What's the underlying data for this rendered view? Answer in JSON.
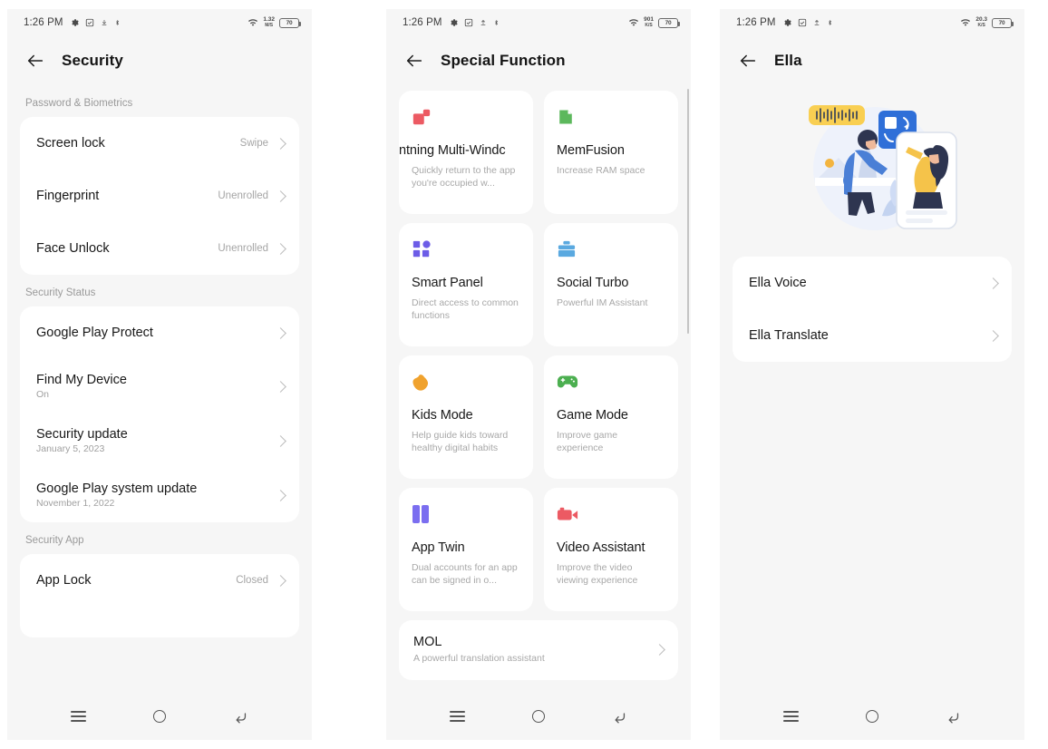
{
  "status_bar": {
    "time": "1:26 PM",
    "icons": [
      "gear-icon",
      "checkbox-icon",
      "download-icon",
      "bluetooth-icon"
    ],
    "wifi": "wifi-icon",
    "battery_level": "70",
    "speeds": [
      "1.32",
      "901",
      "20.3"
    ],
    "speed_units": [
      "M/S",
      "K/S",
      "K/S"
    ]
  },
  "nav_bar": {
    "recents_label": "recents",
    "home_label": "home",
    "back_label": "back"
  },
  "phone1": {
    "title": "Security",
    "groups": [
      {
        "label": "Password & Biometrics",
        "rows": [
          {
            "title": "Screen lock",
            "value": "Swipe",
            "sub": ""
          },
          {
            "title": "Fingerprint",
            "value": "Unenrolled",
            "sub": ""
          },
          {
            "title": "Face Unlock",
            "value": "Unenrolled",
            "sub": ""
          }
        ]
      },
      {
        "label": "Security Status",
        "rows": [
          {
            "title": "Google Play Protect",
            "value": "",
            "sub": ""
          },
          {
            "title": "Find My Device",
            "value": "",
            "sub": "On"
          },
          {
            "title": "Security update",
            "value": "",
            "sub": "January 5, 2023"
          },
          {
            "title": "Google Play system update",
            "value": "",
            "sub": "November 1, 2022"
          }
        ]
      },
      {
        "label": "Security App",
        "rows": [
          {
            "title": "App Lock",
            "value": "Closed",
            "sub": ""
          }
        ]
      }
    ]
  },
  "phone2": {
    "title": "Special Function",
    "cards": [
      {
        "title": "ntning Multi-Windc",
        "desc": "Quickly return to the app you're occupied w...",
        "icon": "multi-window-icon",
        "color": "#ec5a63",
        "clipped": true
      },
      {
        "title": "MemFusion",
        "desc": "Increase RAM space",
        "icon": "memory-chip-icon",
        "color": "#5cb85c",
        "clipped": false
      },
      {
        "title": "Smart Panel",
        "desc": "Direct access to common functions",
        "icon": "grid-panel-icon",
        "color": "#6c5ce7",
        "clipped": false
      },
      {
        "title": "Social Turbo",
        "desc": "Powerful IM Assistant",
        "icon": "briefcase-icon",
        "color": "#5aa9e0",
        "clipped": false
      },
      {
        "title": "Kids Mode",
        "desc": "Help guide kids toward healthy digital habits",
        "icon": "kids-blob-icon",
        "color": "#f0a22e",
        "clipped": false
      },
      {
        "title": "Game Mode",
        "desc": "Improve game experience",
        "icon": "gamepad-icon",
        "color": "#4caf50",
        "clipped": false
      },
      {
        "title": "App Twin",
        "desc": "Dual accounts for an app can be signed in o...",
        "icon": "app-twin-icon",
        "color": "#7b6ef0",
        "clipped": false
      },
      {
        "title": "Video Assistant",
        "desc": "Improve the video viewing experience",
        "icon": "video-camera-icon",
        "color": "#ec5a63",
        "clipped": false
      }
    ],
    "wide_item": {
      "title": "MOL",
      "desc": "A powerful translation assistant"
    }
  },
  "phone3": {
    "title": "Ella",
    "illustration": "ella-translate-illustration",
    "rows": [
      {
        "title": "Ella Voice"
      },
      {
        "title": "Ella Translate"
      }
    ]
  }
}
